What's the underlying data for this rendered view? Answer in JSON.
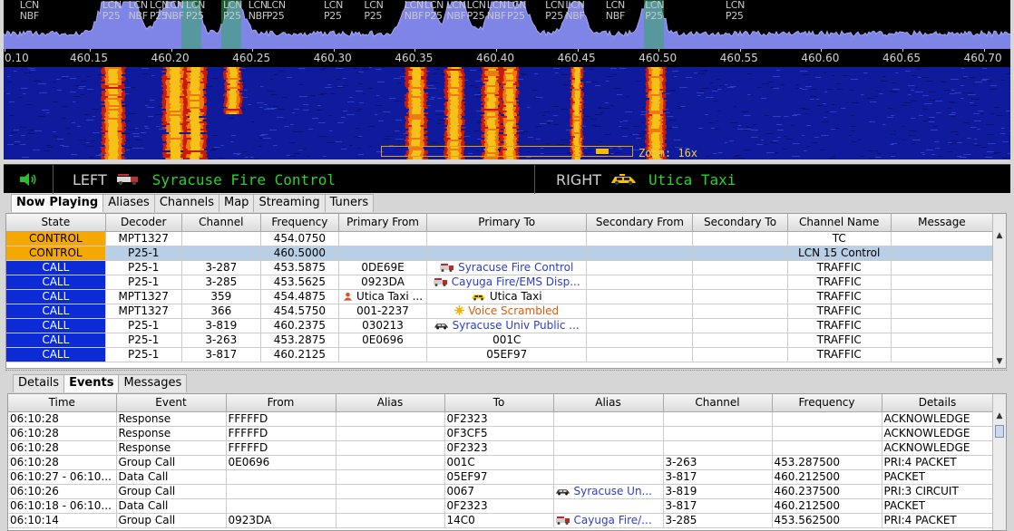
{
  "spectrum": {
    "channel_labels": [
      {
        "text": "LCN\nNBF",
        "pos": 0.016
      },
      {
        "text": "LCN\nP25",
        "pos": 0.098
      },
      {
        "text": "LCN\nNBF",
        "pos": 0.124
      },
      {
        "text": "LCN\nP25",
        "pos": 0.145
      },
      {
        "text": "LCN\nNBF",
        "pos": 0.16
      },
      {
        "text": "LCN\nP25",
        "pos": 0.181
      },
      {
        "text": "LCN\nP25",
        "pos": 0.218
      },
      {
        "text": "LCN\nNBF",
        "pos": 0.243
      },
      {
        "text": "LCN\nP25",
        "pos": 0.261
      },
      {
        "text": "LCN\nP25",
        "pos": 0.318
      },
      {
        "text": "LCN\nP25",
        "pos": 0.358
      },
      {
        "text": "LCN\nNBF",
        "pos": 0.398
      },
      {
        "text": "LCN\nP25",
        "pos": 0.418
      },
      {
        "text": "LCN\nNBF",
        "pos": 0.44
      },
      {
        "text": "LCN\nP25",
        "pos": 0.46
      },
      {
        "text": "LCN\nNBF",
        "pos": 0.48
      },
      {
        "text": "LCN\nP25",
        "pos": 0.5
      },
      {
        "text": "LCN\nP25",
        "pos": 0.538
      },
      {
        "text": "LCN\nNBF",
        "pos": 0.558
      },
      {
        "text": "LCN\nNBF",
        "pos": 0.598
      },
      {
        "text": "LCN\nP25",
        "pos": 0.637
      },
      {
        "text": "LCN\nP25",
        "pos": 0.717
      }
    ],
    "axis_ticks": [
      "0.10",
      "460.15",
      "460.20",
      "460.25",
      "460.30",
      "460.35",
      "460.40",
      "460.45",
      "460.50",
      "460.55",
      "460.60",
      "460.65",
      "460.70"
    ],
    "zoom_label": "Zoom: 16x",
    "colors": {
      "trace": "#7f85e6",
      "traceTop": "#a4a8f0",
      "active": "#35a860",
      "bg": "#000000"
    }
  },
  "now_playing": {
    "left_label": "LEFT",
    "left_value": "Syracuse Fire Control",
    "right_label": "RIGHT",
    "right_value": "Utica Taxi"
  },
  "tabs_top": [
    "Now Playing",
    "Aliases",
    "Channels",
    "Map",
    "Streaming",
    "Tuners"
  ],
  "tabs_top_active": 0,
  "channels_table": {
    "columns": [
      "State",
      "Decoder",
      "Channel",
      "Frequency",
      "Primary From",
      "Primary To",
      "Secondary From",
      "Secondary To",
      "Channel Name",
      "Message"
    ],
    "rows": [
      {
        "state": "CONTROL",
        "decoder": "MPT1327",
        "channel": "",
        "frequency": "454.0750",
        "primary_from": "",
        "primary_to": "",
        "primary_to_icon": "",
        "secondary_from": "",
        "secondary_to": "",
        "channel_name": "TC",
        "message": ""
      },
      {
        "state": "CONTROL",
        "decoder": "P25-1",
        "channel": "",
        "frequency": "460.5000",
        "primary_from": "",
        "primary_to": "",
        "primary_to_icon": "",
        "secondary_from": "",
        "secondary_to": "",
        "channel_name": "LCN 15 Control",
        "message": ""
      },
      {
        "state": "CALL",
        "decoder": "P25-1",
        "channel": "3-287",
        "frequency": "453.5875",
        "primary_from": "0DE69E",
        "primary_to": "Syracuse Fire Control",
        "primary_to_icon": "firetruck-icon",
        "secondary_from": "",
        "secondary_to": "",
        "channel_name": "TRAFFIC",
        "message": ""
      },
      {
        "state": "CALL",
        "decoder": "P25-1",
        "channel": "3-285",
        "frequency": "453.5625",
        "primary_from": "0923DA",
        "primary_to": "Cayuga Fire/EMS Disp...",
        "primary_to_icon": "firetruck-icon",
        "secondary_from": "",
        "secondary_to": "",
        "channel_name": "TRAFFIC",
        "message": ""
      },
      {
        "state": "CALL",
        "decoder": "MPT1327",
        "channel": "359",
        "frequency": "454.4875",
        "primary_from": "Utica Taxi ...",
        "primary_from_icon": "person-icon",
        "primary_to": "Utica Taxi",
        "primary_to_icon": "taxi-icon",
        "secondary_from": "",
        "secondary_to": "",
        "channel_name": "TRAFFIC",
        "message": ""
      },
      {
        "state": "CALL",
        "decoder": "MPT1327",
        "channel": "366",
        "frequency": "454.5750",
        "primary_from": "001-2237",
        "primary_to": "Voice Scrambled",
        "primary_to_icon": "scrambled-icon",
        "secondary_from": "",
        "secondary_to": "",
        "channel_name": "TRAFFIC",
        "message": ""
      },
      {
        "state": "CALL",
        "decoder": "P25-1",
        "channel": "3-819",
        "frequency": "460.2375",
        "primary_from": "030213",
        "primary_to": "Syracuse Univ Public ...",
        "primary_to_icon": "police-car-icon",
        "secondary_from": "",
        "secondary_to": "",
        "channel_name": "TRAFFIC",
        "message": ""
      },
      {
        "state": "CALL",
        "decoder": "P25-1",
        "channel": "3-263",
        "frequency": "453.2875",
        "primary_from": "0E0696",
        "primary_to": "001C",
        "primary_to_icon": "",
        "secondary_from": "",
        "secondary_to": "",
        "channel_name": "TRAFFIC",
        "message": ""
      },
      {
        "state": "CALL",
        "decoder": "P25-1",
        "channel": "3-817",
        "frequency": "460.2125",
        "primary_from": "",
        "primary_to": "05EF97",
        "primary_to_icon": "",
        "secondary_from": "",
        "secondary_to": "",
        "channel_name": "TRAFFIC",
        "message": ""
      }
    ],
    "selected_row": 1
  },
  "tabs_bottom": [
    "Details",
    "Events",
    "Messages"
  ],
  "tabs_bottom_active": 1,
  "events_table": {
    "columns": [
      "Time",
      "Event",
      "From",
      "Alias",
      "To",
      "Alias",
      "Channel",
      "Frequency",
      "Details"
    ],
    "rows": [
      {
        "time": "06:10:28",
        "event": "Response",
        "from": "FFFFFD",
        "from_alias": "",
        "to": "0F2323",
        "to_alias": "",
        "to_alias_icon": "",
        "channel": "",
        "frequency": "",
        "details": "ACKNOWLEDGE"
      },
      {
        "time": "06:10:28",
        "event": "Response",
        "from": "FFFFFD",
        "from_alias": "",
        "to": "0F3CF5",
        "to_alias": "",
        "to_alias_icon": "",
        "channel": "",
        "frequency": "",
        "details": "ACKNOWLEDGE"
      },
      {
        "time": "06:10:28",
        "event": "Response",
        "from": "FFFFFD",
        "from_alias": "",
        "to": "0F2323",
        "to_alias": "",
        "to_alias_icon": "",
        "channel": "",
        "frequency": "",
        "details": "ACKNOWLEDGE"
      },
      {
        "time": "06:10:28",
        "event": "Group Call",
        "from": "0E0696",
        "from_alias": "",
        "to": "001C",
        "to_alias": "",
        "to_alias_icon": "",
        "channel": "3-263",
        "frequency": "453.287500",
        "details": "PRI:4 PACKET"
      },
      {
        "time": "06:10:27 - 06:10...",
        "event": "Data Call",
        "from": "",
        "from_alias": "",
        "to": "05EF97",
        "to_alias": "",
        "to_alias_icon": "",
        "channel": "3-817",
        "frequency": "460.212500",
        "details": "PACKET"
      },
      {
        "time": "06:10:26",
        "event": "Group Call",
        "from": "",
        "from_alias": "",
        "to": "0067",
        "to_alias": "Syracuse Un...",
        "to_alias_icon": "police-car-icon",
        "channel": "3-819",
        "frequency": "460.237500",
        "details": "PRI:3 CIRCUIT"
      },
      {
        "time": "06:10:18 - 06:10...",
        "event": "Data Call",
        "from": "",
        "from_alias": "",
        "to": "0F2323",
        "to_alias": "",
        "to_alias_icon": "",
        "channel": "3-817",
        "frequency": "460.212500",
        "details": "PACKET"
      },
      {
        "time": "06:10:14",
        "event": "Group Call",
        "from": "0923DA",
        "from_alias": "",
        "to": "14C0",
        "to_alias": "Cayuga Fire/...",
        "to_alias_icon": "firetruck-icon",
        "channel": "3-285",
        "frequency": "453.562500",
        "details": "PRI:4 PACKET"
      }
    ]
  }
}
